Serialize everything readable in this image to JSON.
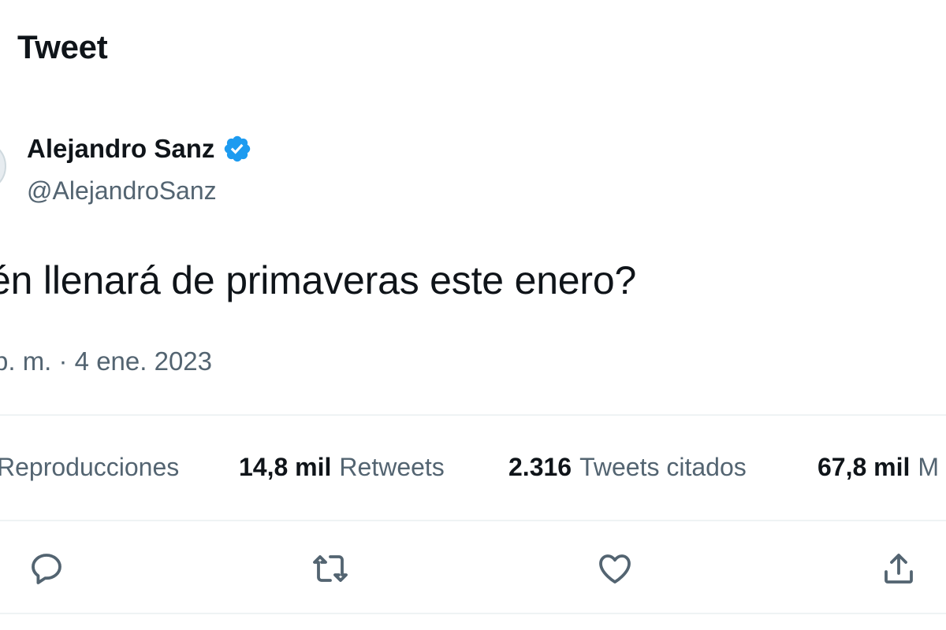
{
  "header": {
    "title": "Tweet"
  },
  "author": {
    "display_name": "Alejandro Sanz",
    "handle": "@AlejandroSanz",
    "verified": true
  },
  "tweet": {
    "text": "én llenará de primaveras este enero?",
    "timestamp": "p. m. · 4 ene. 2023"
  },
  "stats": {
    "views_label": "Reproducciones",
    "retweets_count": "14,8 mil",
    "retweets_label": "Retweets",
    "quotes_count": "2.316",
    "quotes_label": "Tweets citados",
    "likes_count": "67,8 mil",
    "likes_label": "M"
  },
  "actions": {
    "reply_icon": "reply-icon",
    "retweet_icon": "retweet-icon",
    "like_icon": "heart-icon",
    "share_icon": "share-icon"
  },
  "colors": {
    "text_primary": "#0f1419",
    "text_secondary": "#536471",
    "verified_blue": "#1d9bf0",
    "divider": "#eff3f4"
  }
}
